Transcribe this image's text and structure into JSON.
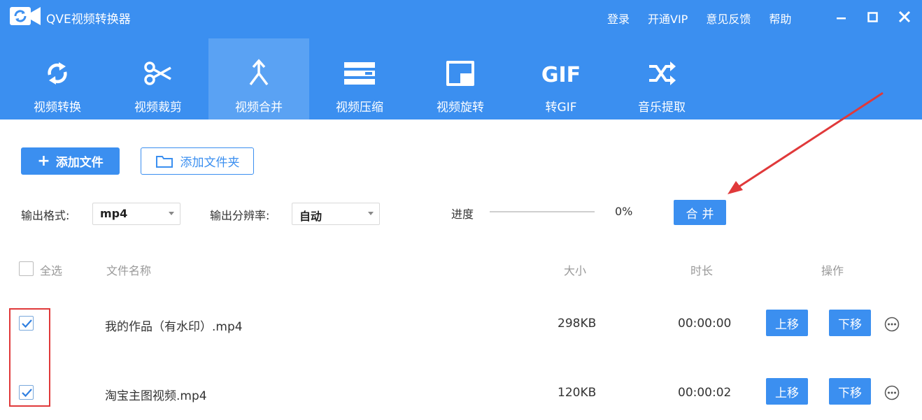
{
  "app": {
    "title": "QVE视频转换器"
  },
  "top_links": [
    "登录",
    "开通VIP",
    "意见反馈",
    "帮助"
  ],
  "nav": [
    {
      "label": "视频转换",
      "icon": "convert-icon"
    },
    {
      "label": "视频裁剪",
      "icon": "scissors-icon"
    },
    {
      "label": "视频合并",
      "icon": "merge-icon",
      "active": true
    },
    {
      "label": "视频压缩",
      "icon": "compress-icon"
    },
    {
      "label": "视频旋转",
      "icon": "rotate-icon"
    },
    {
      "label": "转GIF",
      "icon": "gif-icon"
    },
    {
      "label": "音乐提取",
      "icon": "shuffle-icon"
    }
  ],
  "toolbar": {
    "add_file": "添加文件",
    "add_folder": "添加文件夹"
  },
  "settings": {
    "format_label": "输出格式:",
    "format_value": "mp4",
    "resolution_label": "输出分辨率:",
    "resolution_value": "自动",
    "progress_label": "进度",
    "progress_value": 0,
    "progress_text": "0%",
    "merge_button": "合并"
  },
  "table": {
    "select_all": "全选",
    "headers": {
      "name": "文件名称",
      "size": "大小",
      "duration": "时长",
      "actions": "操作"
    },
    "rows": [
      {
        "checked": true,
        "name": "我的作品（有水印）.mp4",
        "size": "298KB",
        "duration": "00:00:00",
        "up": "上移",
        "down": "下移"
      },
      {
        "checked": true,
        "name": "淘宝主图视频.mp4",
        "size": "120KB",
        "duration": "00:00:02",
        "up": "上移",
        "down": "下移"
      }
    ]
  },
  "colors": {
    "primary": "#3b8ff0",
    "active_tab": "#5aa2f3",
    "annotation": "#e0393a"
  }
}
